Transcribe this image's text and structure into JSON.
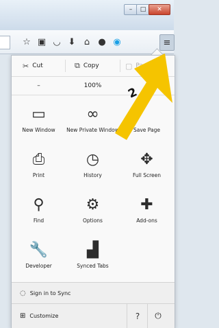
{
  "toolbar": {
    "icons": [
      "star-icon",
      "reading-list-icon",
      "pocket-icon",
      "download-icon",
      "home-icon",
      "chat-icon",
      "skype-icon",
      "hamburger-menu-icon"
    ]
  },
  "edit": {
    "cut": "Cut",
    "copy": "Copy",
    "paste": "Paste"
  },
  "zoom": {
    "minus": "–",
    "level": "100%"
  },
  "grid": [
    {
      "label": "New Window"
    },
    {
      "label": "New Private Window"
    },
    {
      "label": "Save Page"
    },
    {
      "label": "Print"
    },
    {
      "label": "History"
    },
    {
      "label": "Full Screen"
    },
    {
      "label": "Find"
    },
    {
      "label": "Options"
    },
    {
      "label": "Add-ons"
    },
    {
      "label": "Developer"
    },
    {
      "label": "Synced Tabs"
    }
  ],
  "footer": {
    "sign_in": "Sign in to Sync",
    "customize": "Customize"
  },
  "callout": {
    "number": "2",
    "color": "#f5c400"
  }
}
